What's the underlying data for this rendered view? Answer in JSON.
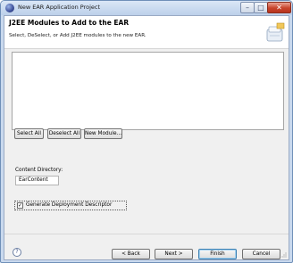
{
  "window": {
    "title": "New EAR Application Project",
    "minimize_symbol": "–",
    "maximize_symbol": "□",
    "close_symbol": "✕"
  },
  "header": {
    "title": "J2EE Modules to Add to the EAR",
    "description": "Select, DeSelect, or Add J2EE modules to the new EAR.",
    "banner_icon": "ear-project-wizard-icon"
  },
  "modules": [],
  "buttons": {
    "select_all": "Select All",
    "deselect_all": "Deselect All",
    "new_module": "New Module..."
  },
  "content_directory": {
    "label": "Content Directory:",
    "value": "EarContent"
  },
  "generate_descriptor": {
    "label": "Generate Deployment Descriptor",
    "checked": true,
    "mark": "✓"
  },
  "footer": {
    "help_symbol": "?",
    "back": "< Back",
    "next": "Next >",
    "finish": "Finish",
    "cancel": "Cancel"
  },
  "colors": {
    "title_bar": "#bcd0ea",
    "close_button": "#c8432b",
    "finish_border": "#3c7fb1"
  }
}
